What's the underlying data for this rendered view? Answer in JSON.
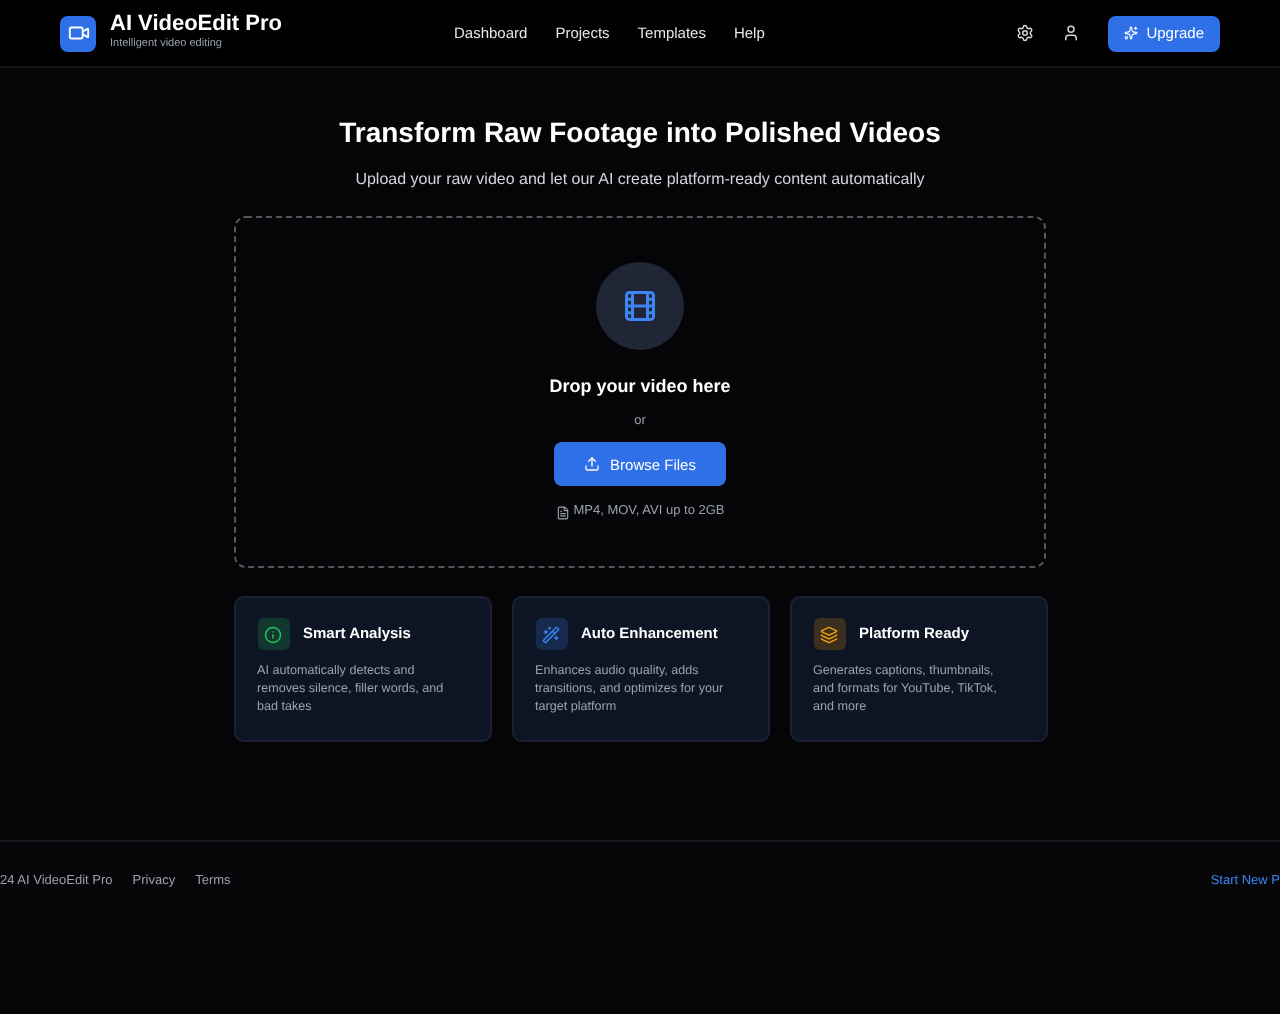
{
  "header": {
    "app_name": "AI VideoEdit Pro",
    "tagline": "Intelligent video editing",
    "nav": [
      "Dashboard",
      "Projects",
      "Templates",
      "Help"
    ],
    "upgrade": "Upgrade"
  },
  "hero": {
    "title": "Transform Raw Footage into Polished Videos",
    "subtitle": "Upload your raw video and let our AI create platform-ready content automatically"
  },
  "dropzone": {
    "heading": "Drop your video here",
    "or": "or",
    "button": "Browse Files",
    "hint": "MP4, MOV, AVI up to 2GB"
  },
  "features": [
    {
      "kind": "analysis",
      "color": "#22c55e",
      "title": "Smart Analysis",
      "text": "AI automatically detects and removes silence, filler words, and bad takes"
    },
    {
      "kind": "enhance",
      "color": "#3b82f6",
      "title": "Auto Enhancement",
      "text": "Enhances audio quality, adds transitions, and optimizes for your target platform"
    },
    {
      "kind": "platform",
      "color": "#f59e0b",
      "title": "Platform Ready",
      "text": "Generates captions, thumbnails, and formats for YouTube, TikTok, and more"
    }
  ],
  "footer": {
    "copyright": "24 AI VideoEdit Pro",
    "links": [
      "Privacy",
      "Terms"
    ],
    "action": "Start New P"
  }
}
